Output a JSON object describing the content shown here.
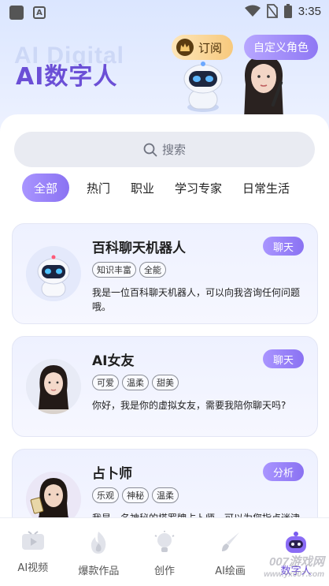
{
  "status_bar": {
    "time": "3:35",
    "icons": [
      "app-icon",
      "notification-a-icon",
      "wifi-icon",
      "no-sim-icon",
      "battery-icon"
    ]
  },
  "header": {
    "title": "AI数字人",
    "subscribe_label": "订阅",
    "custom_role_label": "自定义角色",
    "background_text": "AI Digital"
  },
  "search": {
    "placeholder": "搜索"
  },
  "tabs": [
    {
      "label": "全部",
      "active": true
    },
    {
      "label": "热门",
      "active": false
    },
    {
      "label": "职业",
      "active": false
    },
    {
      "label": "学习专家",
      "active": false
    },
    {
      "label": "日常生活",
      "active": false
    }
  ],
  "cards": [
    {
      "name": "百科聊天机器人",
      "type": "聊天",
      "tags": [
        "知识丰富",
        "全能"
      ],
      "description": "我是一位百科聊天机器人，可以向我咨询任何问题哦。",
      "avatar": "robot-avatar"
    },
    {
      "name": "AI女友",
      "type": "聊天",
      "tags": [
        "可爱",
        "温柔",
        "甜美"
      ],
      "description": "你好，我是你的虚拟女友，需要我陪你聊天吗?",
      "avatar": "girlfriend-avatar"
    },
    {
      "name": "占卜师",
      "type": "分析",
      "tags": [
        "乐观",
        "神秘",
        "温柔"
      ],
      "description": "我是一名神秘的塔罗牌占卜师，可以为您指点迷津",
      "avatar": "fortune-teller-avatar"
    }
  ],
  "bottom_nav": [
    {
      "label": "AI视频",
      "icon": "video-icon",
      "active": false
    },
    {
      "label": "爆款作品",
      "icon": "flame-icon",
      "active": false
    },
    {
      "label": "创作",
      "icon": "lightbulb-icon",
      "active": false
    },
    {
      "label": "AI绘画",
      "icon": "brush-icon",
      "active": false
    },
    {
      "label": "数字人",
      "icon": "digital-human-icon",
      "active": true
    }
  ],
  "watermark": {
    "line1": "007游戏网",
    "line2": "www.yx007.com"
  },
  "colors": {
    "accent": "#8a72f2",
    "title": "#6b4fd6",
    "gold": "#f7c97d"
  }
}
